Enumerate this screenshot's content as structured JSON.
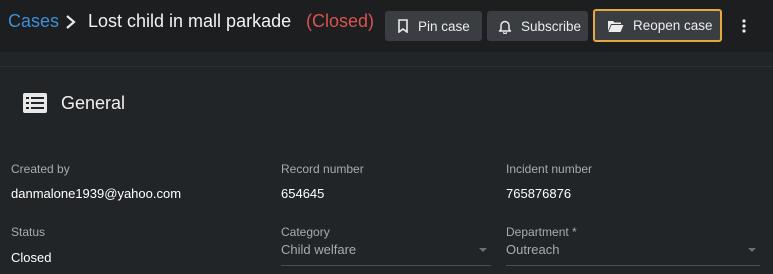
{
  "header": {
    "breadcrumb_root": "Cases",
    "case_title": "Lost child in mall parkade",
    "case_status": "(Closed)",
    "status_color": "#d9534f"
  },
  "toolbar": {
    "pin_label": "Pin case",
    "subscribe_label": "Subscribe",
    "reopen_label": "Reopen case",
    "highlight_color": "#e5a93c"
  },
  "section": {
    "title": "General",
    "icon": "list-icon"
  },
  "fields": {
    "created_by": {
      "label": "Created by",
      "value": "danmalone1939@yahoo.com"
    },
    "record_number": {
      "label": "Record number",
      "value": "654645"
    },
    "incident_number": {
      "label": "Incident number",
      "value": "765876876"
    },
    "status": {
      "label": "Status",
      "value": "Closed"
    },
    "category": {
      "label": "Category",
      "value": "Child welfare"
    },
    "department": {
      "label": "Department *",
      "value": "Outreach"
    }
  }
}
